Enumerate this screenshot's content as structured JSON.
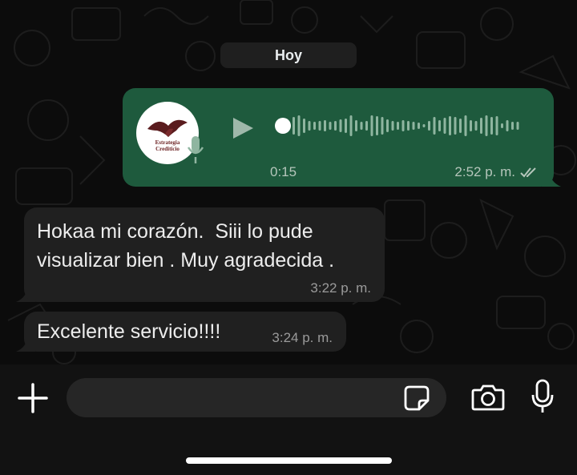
{
  "chat": {
    "date_label": "Hoy",
    "voice_message": {
      "avatar_line1": "Estrategia",
      "avatar_line2": "Crediticio",
      "duration": "0:15",
      "time": "2:52 p. m.",
      "status": "read"
    },
    "messages": [
      {
        "text_line1": "Hokaa mi corazón.  Siii lo pude",
        "text_line2": "visualizar bien . Muy agradecida .",
        "time": "3:22 p. m."
      },
      {
        "text": "Excelente servicio!!!!",
        "time": "3:24 p. m."
      }
    ]
  },
  "composer": {
    "input_value": "",
    "icons": [
      "plus-icon",
      "sticker-icon",
      "camera-icon",
      "microphone-icon"
    ]
  },
  "colors": {
    "outgoing_bubble": "#1e5a3d",
    "incoming_bubble": "#202020",
    "background": "#0c0c0c"
  }
}
